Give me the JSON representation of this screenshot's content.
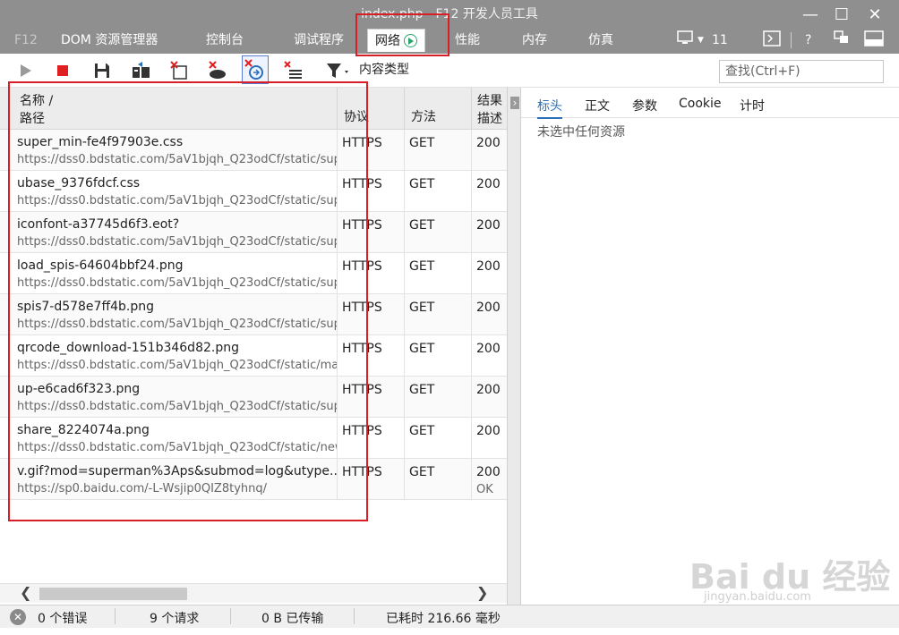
{
  "window": {
    "title": "index.php - F12 开发人员工具",
    "minimize": "—",
    "maximize": "☐",
    "close": "✕"
  },
  "tabs": {
    "f12": "F12",
    "dom": "DOM 资源管理器",
    "console": "控制台",
    "debugger": "调试程序",
    "network": "网络",
    "performance": "性能",
    "memory": "内存",
    "emulation": "仿真",
    "emulation_count": "11",
    "help": "?"
  },
  "toolbar": {
    "content_type_label": "内容类型",
    "search_placeholder": "查找(Ctrl+F)"
  },
  "table": {
    "headers": {
      "name_line1": "名称 /",
      "name_line2": "路径",
      "protocol": "协议",
      "method": "方法",
      "result_line1": "结果",
      "result_line2": "描述"
    },
    "rows": [
      {
        "name": "super_min-fe4f97903e.css",
        "url": "https://dss0.bdstatic.com/5aV1bjqh_Q23odCf/static/sup...",
        "protocol": "HTTPS",
        "method": "GET",
        "result": "200",
        "desc": ""
      },
      {
        "name": "ubase_9376fdcf.css",
        "url": "https://dss0.bdstatic.com/5aV1bjqh_Q23odCf/static/sup...",
        "protocol": "HTTPS",
        "method": "GET",
        "result": "200",
        "desc": ""
      },
      {
        "name": "iconfont-a37745d6f3.eot?",
        "url": "https://dss0.bdstatic.com/5aV1bjqh_Q23odCf/static/sup...",
        "protocol": "HTTPS",
        "method": "GET",
        "result": "200",
        "desc": ""
      },
      {
        "name": "load_spis-64604bbf24.png",
        "url": "https://dss0.bdstatic.com/5aV1bjqh_Q23odCf/static/sup...",
        "protocol": "HTTPS",
        "method": "GET",
        "result": "200",
        "desc": ""
      },
      {
        "name": "spis7-d578e7ff4b.png",
        "url": "https://dss0.bdstatic.com/5aV1bjqh_Q23odCf/static/sup...",
        "protocol": "HTTPS",
        "method": "GET",
        "result": "200",
        "desc": ""
      },
      {
        "name": "qrcode_download-151b346d82.png",
        "url": "https://dss0.bdstatic.com/5aV1bjqh_Q23odCf/static/ma...",
        "protocol": "HTTPS",
        "method": "GET",
        "result": "200",
        "desc": ""
      },
      {
        "name": "up-e6cad6f323.png",
        "url": "https://dss0.bdstatic.com/5aV1bjqh_Q23odCf/static/sup...",
        "protocol": "HTTPS",
        "method": "GET",
        "result": "200",
        "desc": ""
      },
      {
        "name": "share_8224074a.png",
        "url": "https://dss0.bdstatic.com/5aV1bjqh_Q23odCf/static/new...",
        "protocol": "HTTPS",
        "method": "GET",
        "result": "200",
        "desc": ""
      },
      {
        "name": "v.gif?mod=superman%3Aps&submod=log&utype...",
        "url": "https://sp0.baidu.com/-L-Wsjip0QIZ8tyhnq/",
        "protocol": "HTTPS",
        "method": "GET",
        "result": "200",
        "desc": "OK"
      }
    ]
  },
  "details": {
    "tabs": [
      "标头",
      "正文",
      "参数",
      "Cookie",
      "计时"
    ],
    "active_tab": "标头",
    "empty_text": "未选中任何资源"
  },
  "status": {
    "errors": "0 个错误",
    "requests": "9 个请求",
    "transferred": "0 B 已传输",
    "elapsed": "已耗时 216.66 毫秒"
  },
  "watermark": {
    "logo": "Bai du 经验",
    "domain": "jingyan.baidu.com"
  },
  "colors": {
    "titlebar": "#8f8f8f",
    "highlight": "#d81e26",
    "network_icon": "#2aa36b",
    "record": "#e02020",
    "active_detail_tab": "#2a6fb7"
  }
}
